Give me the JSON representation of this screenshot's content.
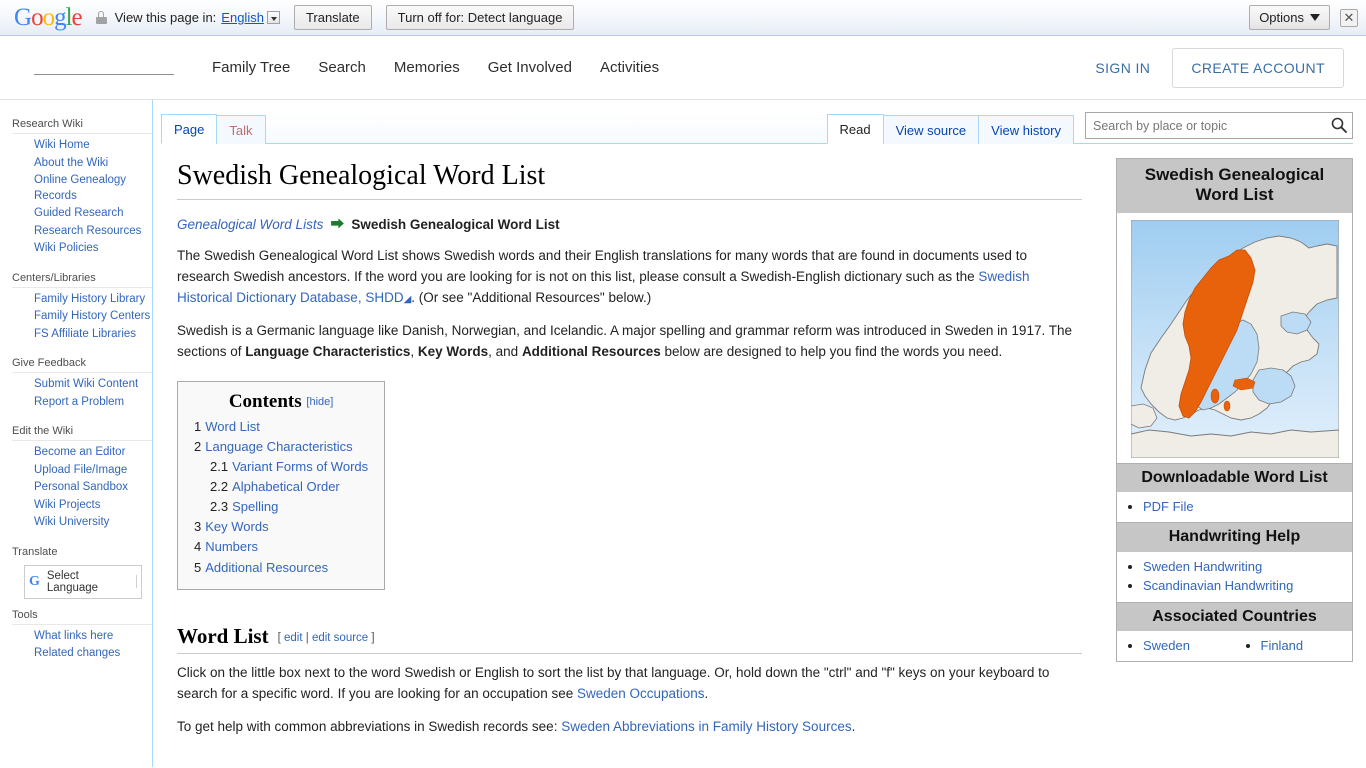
{
  "translate_bar": {
    "logo_text": "Google",
    "lock_icon": "lock-icon",
    "label": "View this page in:",
    "language": "English",
    "translate_button": "Translate",
    "turn_off_button": "Turn off for: Detect language",
    "options_button": "Options",
    "close_icon": "✕"
  },
  "site_header": {
    "nav": [
      {
        "label": "Family Tree"
      },
      {
        "label": "Search"
      },
      {
        "label": "Memories"
      },
      {
        "label": "Get Involved"
      },
      {
        "label": "Activities"
      }
    ],
    "sign_in": "SIGN IN",
    "create_account": "CREATE ACCOUNT"
  },
  "sidebar": {
    "groups": [
      {
        "heading": "Research Wiki",
        "items": [
          {
            "label": "Wiki Home"
          },
          {
            "label": "About the Wiki"
          },
          {
            "label": "Online Genealogy Records"
          },
          {
            "label": "Guided Research"
          },
          {
            "label": "Research Resources"
          },
          {
            "label": "Wiki Policies"
          }
        ]
      },
      {
        "heading": "Centers/Libraries",
        "items": [
          {
            "label": "Family History Library"
          },
          {
            "label": "Family History Centers"
          },
          {
            "label": "FS Affiliate Libraries"
          }
        ]
      },
      {
        "heading": "Give Feedback",
        "items": [
          {
            "label": "Submit Wiki Content"
          },
          {
            "label": "Report a Problem"
          }
        ]
      },
      {
        "heading": "Edit the Wiki",
        "items": [
          {
            "label": "Become an Editor"
          },
          {
            "label": "Upload File/Image"
          },
          {
            "label": "Personal Sandbox"
          },
          {
            "label": "Wiki Projects"
          },
          {
            "label": "Wiki University"
          }
        ]
      }
    ],
    "translate_heading": "Translate",
    "select_language": "Select Language",
    "tools_heading": "Tools",
    "tools_items": [
      {
        "label": "What links here"
      },
      {
        "label": "Related changes"
      }
    ]
  },
  "tabs": {
    "left": [
      {
        "label": "Page",
        "selected": true
      },
      {
        "label": "Talk",
        "selected": false,
        "style": "red"
      }
    ],
    "right": [
      {
        "label": "Read",
        "selected": true
      },
      {
        "label": "View source",
        "selected": false
      },
      {
        "label": "View history",
        "selected": false
      }
    ]
  },
  "search": {
    "placeholder": "Search by place or topic",
    "value": "",
    "icon": "search-icon"
  },
  "article": {
    "title": "Swedish Genealogical Word List",
    "breadcrumb": {
      "parent": "Genealogical Word Lists",
      "arrow": "⮕",
      "current": "Swedish Genealogical Word List"
    },
    "paragraph1": {
      "part1": "The Swedish Genealogical Word List shows Swedish words and their English translations for many words that are found in documents used to research Swedish ancestors. If the word you are looking for is not on this list, please consult a Swedish-English dictionary such as the ",
      "link": "Swedish Historical Dictionary Database, SHDD",
      "part2": ". (Or see \"Additional Resources\" below.)"
    },
    "paragraph2": {
      "part1": "Swedish is a Germanic language like Danish, Norwegian, and Icelandic. A major spelling and grammar reform was introduced in Sweden in 1917. The sections of ",
      "bold1": "Language Characteristics",
      "sep1": ", ",
      "bold2": "Key Words",
      "sep2": ", and ",
      "bold3": "Additional Resources",
      "part2": " below are designed to help you find the words you need."
    },
    "toc": {
      "title": "Contents",
      "hide_label": "[hide]",
      "entries": [
        {
          "num": "1",
          "label": "Word List",
          "level": 1
        },
        {
          "num": "2",
          "label": "Language Characteristics",
          "level": 1
        },
        {
          "num": "2.1",
          "label": "Variant Forms of Words",
          "level": 2
        },
        {
          "num": "2.2",
          "label": "Alphabetical Order",
          "level": 2
        },
        {
          "num": "2.3",
          "label": "Spelling",
          "level": 2
        },
        {
          "num": "3",
          "label": "Key Words",
          "level": 1
        },
        {
          "num": "4",
          "label": "Numbers",
          "level": 1
        },
        {
          "num": "5",
          "label": "Additional Resources",
          "level": 1
        }
      ]
    },
    "section1": {
      "heading": "Word List",
      "edit": "edit",
      "edit_source": "edit source",
      "paragraph1": {
        "part1": "Click on the little box next to the word Swedish or English to sort the list by that language. Or, hold down the \"ctrl\" and \"f\" keys on your keyboard to search for a specific word. If you are looking for an occupation see ",
        "link": "Sweden Occupations",
        "part2": "."
      },
      "paragraph2": {
        "part1": "To get help with common abbreviations in Swedish records see: ",
        "link": "Sweden Abbreviations in Family History Sources",
        "part2": "."
      }
    }
  },
  "infobox": {
    "title": "Swedish Genealogical Word List",
    "map_alt": "sweden-map-image",
    "sections": [
      {
        "heading": "Downloadable Word List",
        "items": [
          {
            "label": "PDF File"
          }
        ]
      },
      {
        "heading": "Handwriting Help",
        "items": [
          {
            "label": "Sweden Handwriting"
          },
          {
            "label": "Scandinavian Handwriting"
          }
        ]
      },
      {
        "heading": "Associated Countries",
        "items": [
          {
            "label": "Sweden"
          },
          {
            "label": "Finland"
          }
        ]
      }
    ]
  },
  "colors": {
    "link": "#3366bb",
    "wiki_link": "#0645ad",
    "redlink": "#ba6f6f",
    "tab_border": "#a7d7f9",
    "infobox_header_bg": "#c6c6c6",
    "map_highlight": "#e8620c",
    "map_sea": "#bcdcf5",
    "brand_blue": "#3a6ea5",
    "arrow_green": "#1a7d2e"
  }
}
